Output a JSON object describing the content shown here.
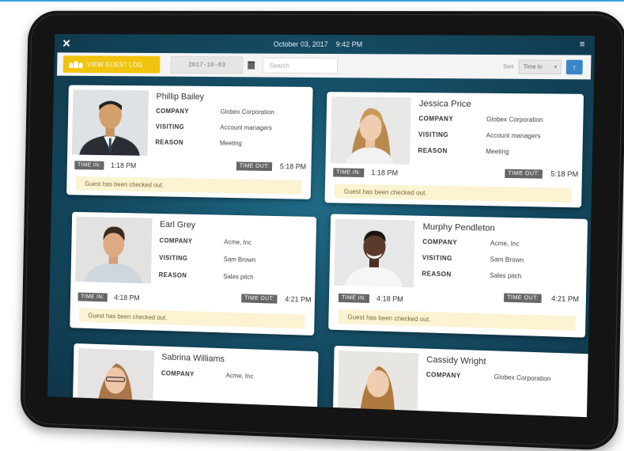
{
  "status": {
    "date": "October 03, 2017",
    "time": "9:42 PM"
  },
  "toolbar": {
    "guest_log_label": "VIEW GUEST LOG",
    "date_value": "2017-10-03",
    "search_placeholder": "Search",
    "sort_label": "Sort",
    "sort_value": "Time In"
  },
  "labels": {
    "company": "COMPANY",
    "visiting": "VISITING",
    "reason": "REASON",
    "time_in": "TIME IN:",
    "time_out": "TIME OUT:"
  },
  "guests": [
    {
      "name": "Phillip Bailey",
      "company": "Globex Corporation",
      "visiting": "Account managers",
      "reason": "Meeting",
      "time_in": "1:18 PM",
      "time_out": "5:18 PM",
      "status": "Guest has been checked out."
    },
    {
      "name": "Jessica Price",
      "company": "Globex Corporation",
      "visiting": "Account managers",
      "reason": "Meeting",
      "time_in": "1:18 PM",
      "time_out": "5:18 PM",
      "status": "Guest has been checked out."
    },
    {
      "name": "Earl Grey",
      "company": "Acme, Inc",
      "visiting": "Sam Brown",
      "reason": "Sales pitch",
      "time_in": "4:18 PM",
      "time_out": "4:21 PM",
      "status": "Guest has been checked out."
    },
    {
      "name": "Murphy Pendleton",
      "company": "Acme, Inc",
      "visiting": "Sam Brown",
      "reason": "Sales pitch",
      "time_in": "4:18 PM",
      "time_out": "4:21 PM",
      "status": "Guest has been checked out."
    },
    {
      "name": "Sabrina Williams",
      "company": "Acme, Inc"
    },
    {
      "name": "Cassidy Wright",
      "company": "Globex Corporation"
    }
  ],
  "colors": {
    "accent": "#f1c40f",
    "sort_button": "#3a86c8",
    "notice_bg": "#fbf3d2",
    "screen_bg": "#154e66"
  },
  "icons": [
    "close-icon",
    "menu-icon",
    "people-icon",
    "calendar-icon",
    "arrow-up-icon"
  ]
}
